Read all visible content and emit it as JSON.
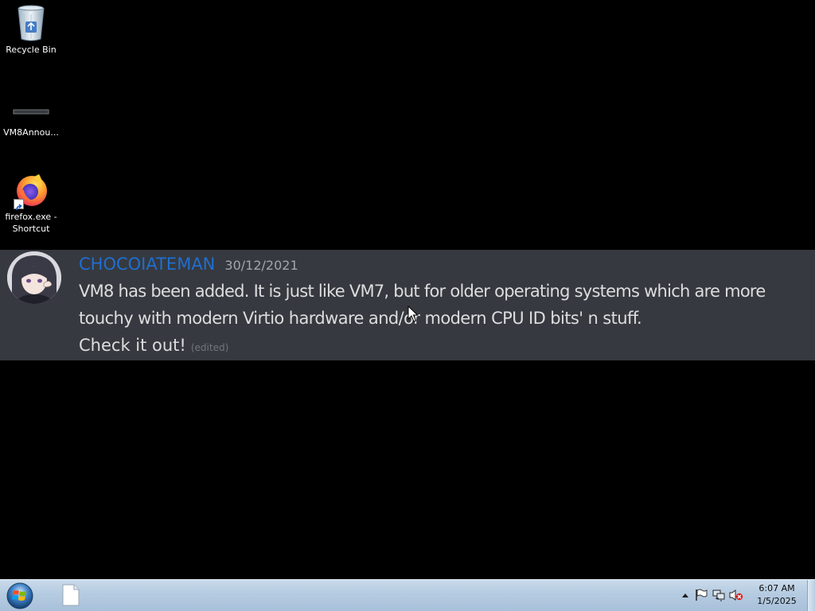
{
  "desktop": {
    "icons": [
      {
        "label": "Recycle Bin",
        "icon": "recycle-bin-icon"
      },
      {
        "label": "VM8Annou...",
        "icon": "image-file-icon"
      },
      {
        "label": "firefox.exe - Shortcut",
        "icon": "firefox-icon"
      }
    ]
  },
  "message": {
    "author": "CHOCOIATEMAN",
    "date": "30/12/2021",
    "lines": [
      "VM8 has been added. It is just like VM7, but for older operating systems which are more",
      "touchy with modern Virtio hardware and/or modern CPU ID bits' n stuff.",
      "Check it out!"
    ],
    "edited": "(edited)",
    "colors": {
      "background": "#36393f",
      "author": "#1f6fd0",
      "text": "#dcddde",
      "meta": "#a3a6aa"
    }
  },
  "taskbar": {
    "start_icon": "windows-orb-icon",
    "items": [
      {
        "icon": "blank-document-icon"
      }
    ],
    "tray": {
      "icons": [
        "show-hidden-icons-arrow",
        "action-center-flag-icon",
        "network-icon",
        "volume-muted-icon"
      ],
      "time": "6:07 AM",
      "date": "1/5/2025"
    }
  }
}
